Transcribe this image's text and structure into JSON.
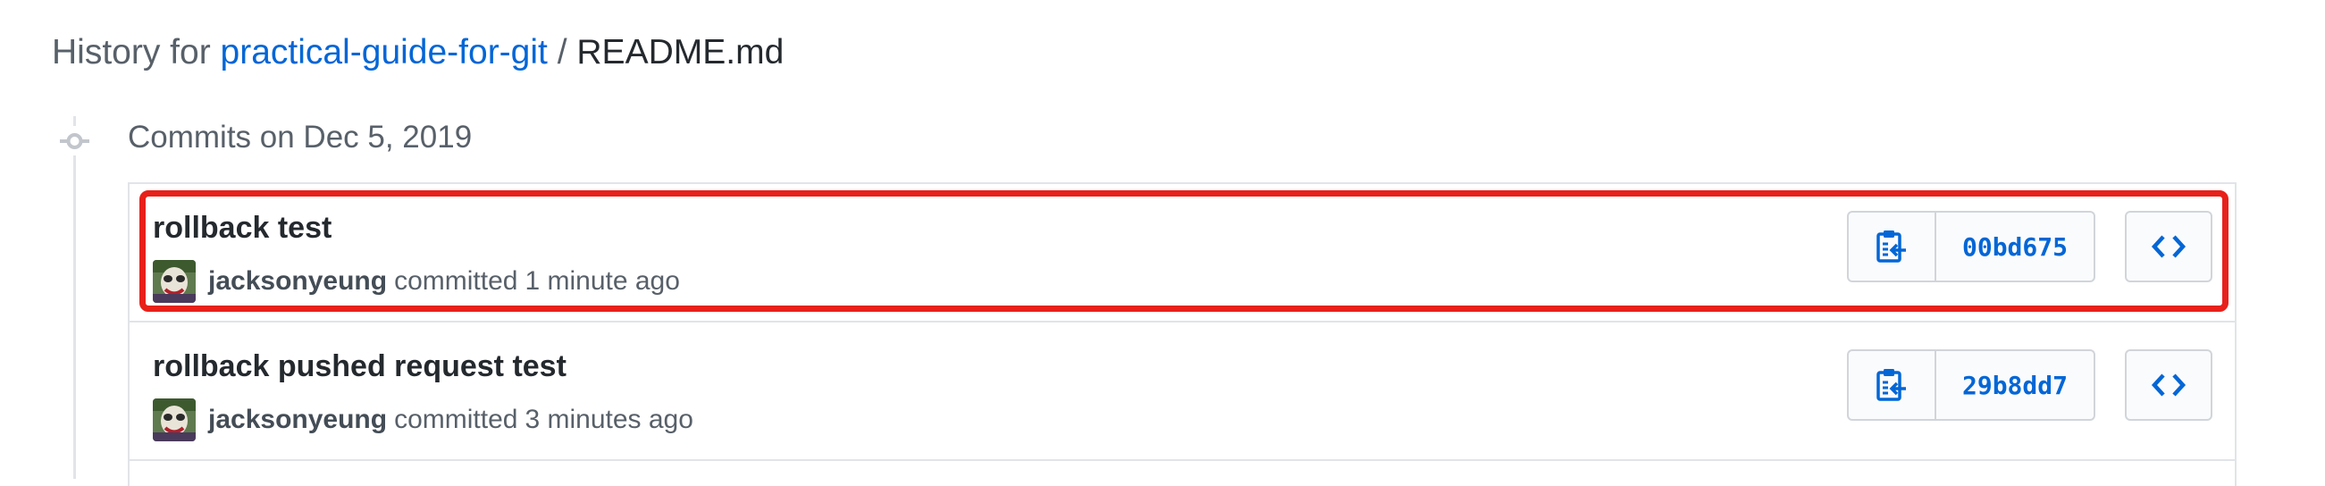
{
  "header": {
    "prefix": "History for",
    "repo": "practical-guide-for-git",
    "separator": "/",
    "file": "README.md"
  },
  "timeline": {
    "date_label": "Commits on Dec 5, 2019"
  },
  "commits": [
    {
      "title": "rollback test",
      "author": "jacksonyeung",
      "action": "committed",
      "time": "1 minute ago",
      "sha": "00bd675",
      "highlighted": true
    },
    {
      "title": "rollback pushed request test",
      "author": "jacksonyeung",
      "action": "committed",
      "time": "3 minutes ago",
      "sha": "29b8dd7",
      "highlighted": false
    }
  ],
  "colors": {
    "link": "#0366d6",
    "highlight": "#e8201a",
    "border": "#e1e4e8"
  },
  "icons": {
    "commit_node": "git-commit-icon",
    "copy": "clipboard-copy-icon",
    "browse": "code-icon"
  }
}
